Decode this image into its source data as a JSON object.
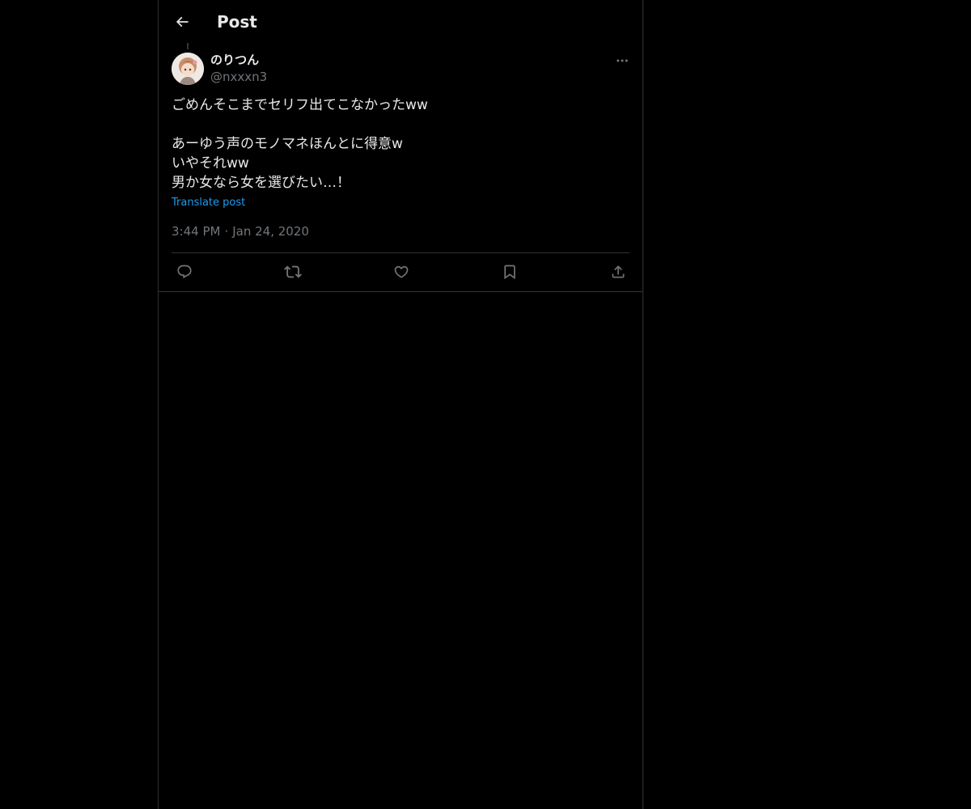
{
  "header": {
    "title": "Post",
    "back_icon": "arrow-left-icon"
  },
  "post": {
    "author": {
      "display_name": "のりつん",
      "handle": "@nxxxn3"
    },
    "lines": [
      "ごめんそこまでセリフ出てこなかったww",
      "",
      "あーゆう声のモノマネほんとに得意w",
      "いやそれww",
      "男か女なら女を選びたい…！"
    ],
    "translate_label": "Translate post",
    "time": "3:44 PM",
    "separator": "·",
    "date": "Jan 24, 2020"
  },
  "actions": [
    {
      "name": "reply",
      "icon": "reply-icon"
    },
    {
      "name": "repost",
      "icon": "repost-icon"
    },
    {
      "name": "like",
      "icon": "heart-icon"
    },
    {
      "name": "bookmark",
      "icon": "bookmark-icon"
    },
    {
      "name": "share",
      "icon": "share-icon"
    }
  ],
  "colors": {
    "background": "#000000",
    "text": "#e7e9ea",
    "secondary_text": "#71767b",
    "link": "#1d9bf0",
    "border": "#2f3336"
  }
}
